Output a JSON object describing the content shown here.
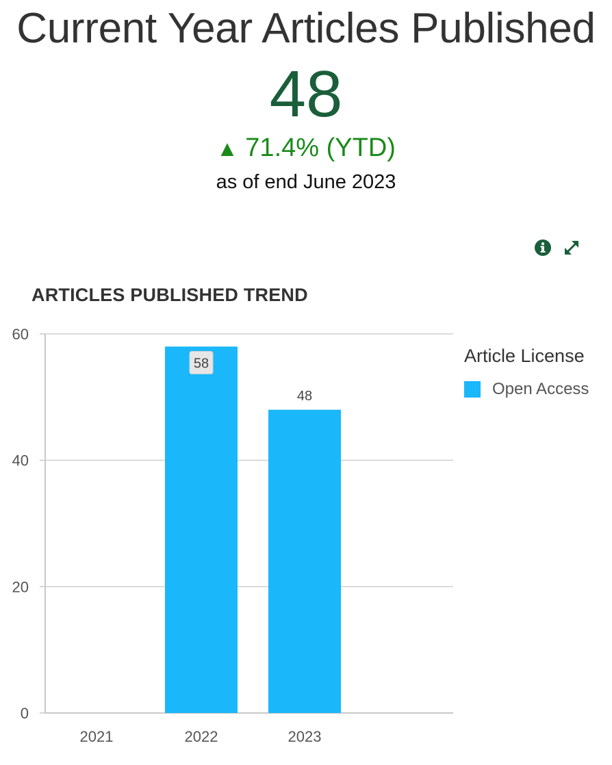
{
  "kpi": {
    "title": "Current Year Articles Published",
    "value": "48",
    "change_arrow": "▲",
    "change_text": "71.4% (YTD)",
    "as_of": "as of end June 2023",
    "value_color": "#1a5e3a",
    "change_color": "#1a8a1a"
  },
  "tools": {
    "info_icon": "info-icon",
    "expand_icon": "expand-icon",
    "icon_color": "#1a5e3a"
  },
  "chart_data": {
    "type": "bar",
    "title": "ARTICLES PUBLISHED TREND",
    "xlabel": "",
    "ylabel": "",
    "categories": [
      "2021",
      "2022",
      "2023"
    ],
    "series": [
      {
        "name": "Open Access",
        "values": [
          null,
          58,
          48
        ],
        "color": "#1ab7fb"
      }
    ],
    "data_labels": [
      "",
      "58",
      "48"
    ],
    "yticks": [
      0,
      20,
      40,
      60
    ],
    "ylim": [
      0,
      60
    ],
    "grid": true,
    "legend": {
      "title": "Article License",
      "placement": "right"
    }
  }
}
